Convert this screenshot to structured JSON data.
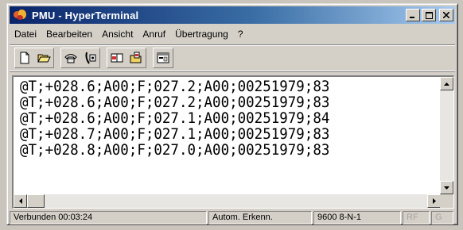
{
  "window": {
    "title": "PMU - HyperTerminal",
    "icon": "hyperterminal-app-icon",
    "controls": [
      "minimize",
      "maximize",
      "close"
    ]
  },
  "menu": {
    "items": [
      "Datei",
      "Bearbeiten",
      "Ansicht",
      "Anruf",
      "Übertragung",
      "?"
    ]
  },
  "toolbar": {
    "buttons": [
      "new-connection-icon",
      "open-folder-icon",
      "connect-phone-icon",
      "disconnect-phone-icon",
      "send-file-icon",
      "receive-file-icon",
      "properties-icon"
    ]
  },
  "terminal": {
    "lines": [
      "@T;+028.6;A00;F;027.2;A00;00251979;83",
      "@T;+028.6;A00;F;027.2;A00;00251979;83",
      "@T;+028.6;A00;F;027.1;A00;00251979;84",
      "@T;+028.7;A00;F;027.1;A00;00251979;83",
      "@T;+028.8;A00;F;027.0;A00;00251979;83"
    ]
  },
  "status": {
    "connected": "Verbunden 00:03:24",
    "detect": "Autom. Erkenn.",
    "port_settings": "9600 8-N-1",
    "rf": "RF",
    "g": "G"
  }
}
